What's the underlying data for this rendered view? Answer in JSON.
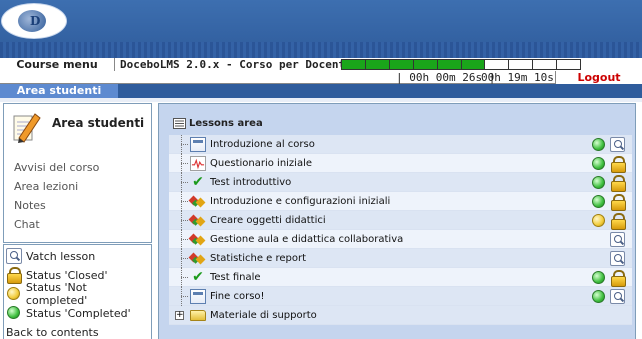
{
  "header": {
    "logo_text": "D"
  },
  "bar": {
    "course_menu": "Course menu",
    "course_title": "DoceboLMS 2.0.x - Corso per Docenti",
    "progress": {
      "segments": 10,
      "completed": 6
    }
  },
  "timer": {
    "time_spent": "| 00h 00m 26s |",
    "time_total": "00h 19m 10s",
    "logout": "Logout"
  },
  "tabs": {
    "active": "Area studenti"
  },
  "sidebar": {
    "title": "Area studenti",
    "links": [
      "Avvisi del corso",
      "Area lezioni",
      "Notes",
      "Chat"
    ]
  },
  "legend": {
    "items": [
      {
        "icon": "magnifier-icon",
        "label": "Vatch lesson"
      },
      {
        "icon": "lock-icon",
        "label": "Status 'Closed'"
      },
      {
        "icon": "yellow-dot-icon",
        "label": "Status 'Not completed'"
      },
      {
        "icon": "green-dot-icon",
        "label": "Status 'Completed'"
      }
    ],
    "back": "Back to contents"
  },
  "lessons_area": {
    "title": "Lessons area",
    "rows": [
      {
        "label": "Introduzione al corso",
        "icon": "document-icon",
        "status": "completed",
        "action": "view"
      },
      {
        "label": "Questionario iniziale",
        "icon": "poll-icon",
        "status": "completed",
        "action": "locked"
      },
      {
        "label": "Test introduttivo",
        "icon": "check-icon",
        "status": "completed",
        "action": "locked"
      },
      {
        "label": "Introduzione e configurazioni iniziali",
        "icon": "learning-objects-icon",
        "status": "completed",
        "action": "locked"
      },
      {
        "label": "Creare oggetti didattici",
        "icon": "learning-objects-icon",
        "status": "not_completed",
        "action": "locked"
      },
      {
        "label": "Gestione aula e didattica collaborativa",
        "icon": "learning-objects-icon",
        "status": "none",
        "action": "view"
      },
      {
        "label": "Statistiche e report",
        "icon": "learning-objects-icon",
        "status": "none",
        "action": "view"
      },
      {
        "label": "Test finale",
        "icon": "check-icon",
        "status": "completed",
        "action": "locked"
      },
      {
        "label": "Fine corso!",
        "icon": "document-icon",
        "status": "completed",
        "action": "view"
      }
    ],
    "folder": "Materiale di supporto"
  },
  "colors": {
    "header_blue": "#2f5c9c",
    "progress_green": "#1aa51a",
    "logout_red": "#cc0000",
    "panel_bg": "#c5d5ee"
  }
}
